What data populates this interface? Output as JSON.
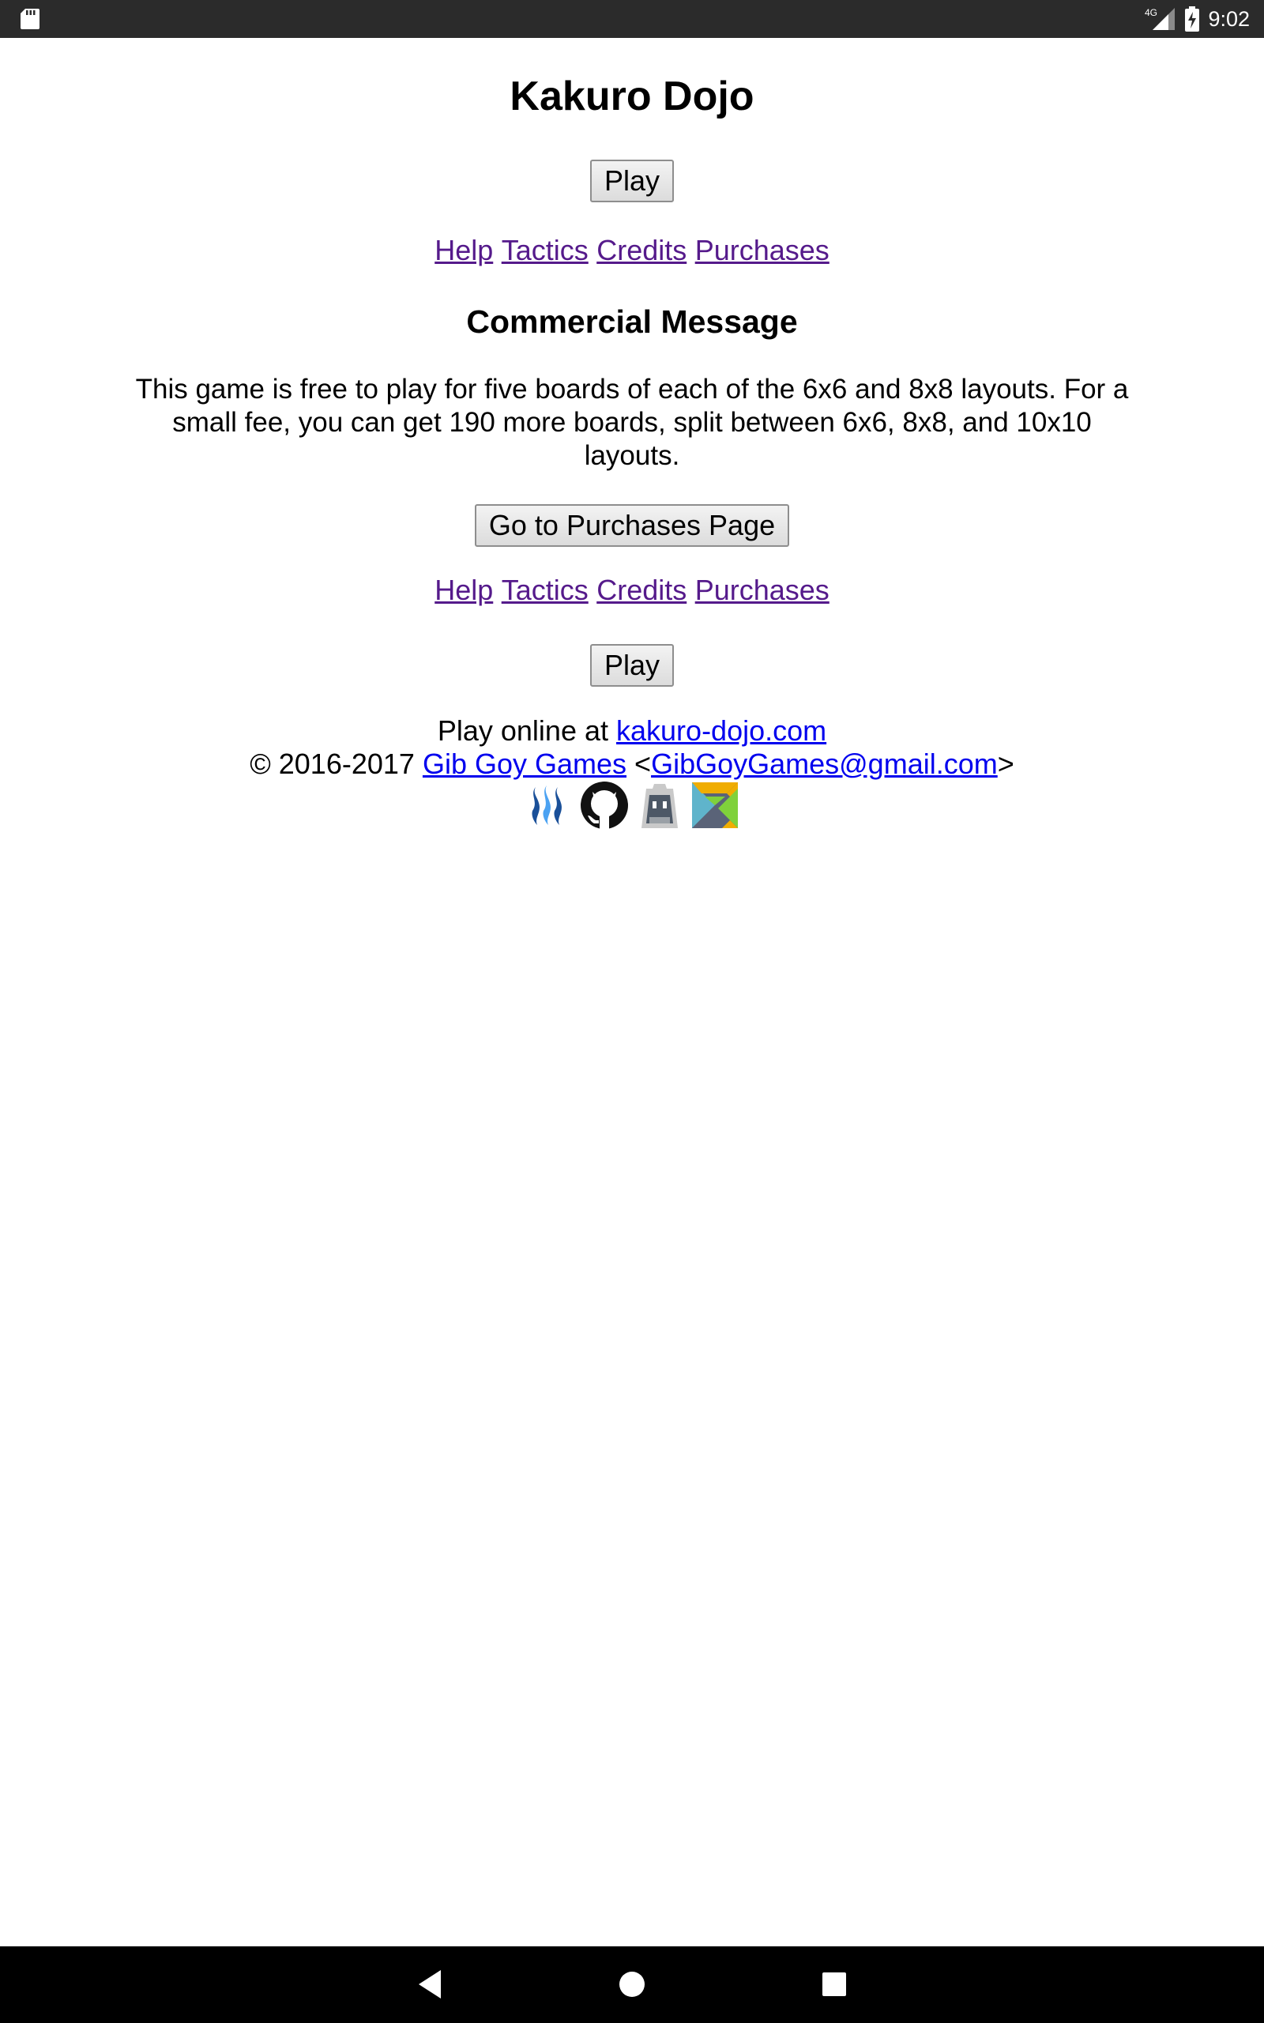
{
  "status_bar": {
    "network": "4G",
    "time": "9:02"
  },
  "page": {
    "title": "Kakuro Dojo",
    "play_label": "Play",
    "nav_links": [
      "Help",
      "Tactics",
      "Credits",
      "Purchases"
    ],
    "commercial": {
      "heading": "Commercial Message",
      "body": "This game is free to play for five boards of each of the 6x6 and 8x8 layouts. For a small fee, you can get 190 more boards, split between 6x6, 8x8, and 10x10 layouts.",
      "button_label": "Go to Purchases Page"
    },
    "footer": {
      "play_online_prefix": "Play online at ",
      "site_link": "kakuro-dojo.com",
      "copyright_prefix": "© 2016-2017 ",
      "company_link": "Gib Goy Games",
      "email_open": " <",
      "email_link": "GibGoyGames@gmail.com",
      "email_close": ">"
    },
    "badges": [
      "steemit-icon",
      "github-icon",
      "cordova-icon",
      "elm-icon"
    ]
  },
  "colors": {
    "link_visited": "#551a8b",
    "link": "#0000ee",
    "status_bar_bg": "#2b2b2b",
    "nav_bar_bg": "#000000"
  }
}
